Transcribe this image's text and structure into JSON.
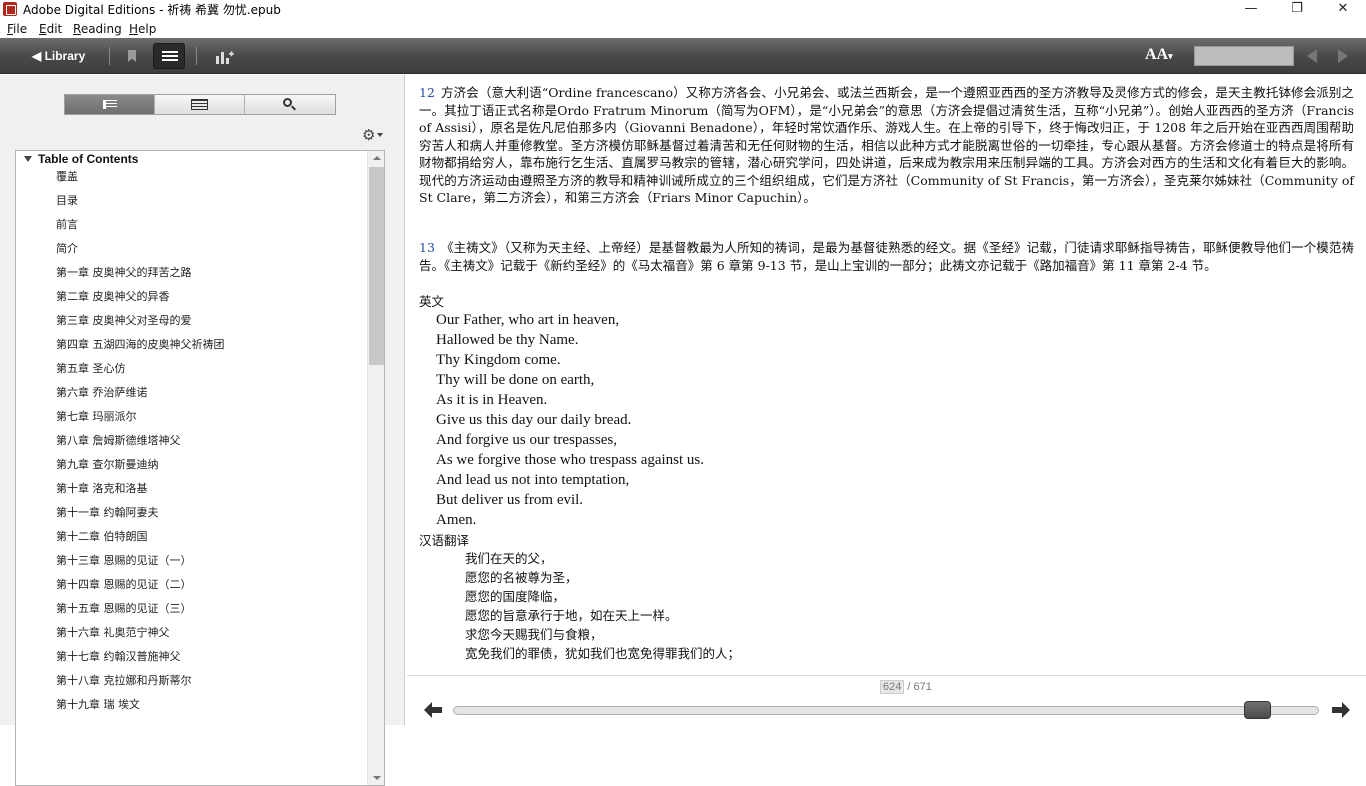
{
  "window": {
    "title": "Adobe Digital Editions - 祈祷 希冀 勿忧.epub",
    "minimize": "—",
    "maximize": "❐",
    "close": "✕"
  },
  "menu": [
    {
      "key": "F",
      "rest": "ile"
    },
    {
      "key": "E",
      "rest": "dit"
    },
    {
      "key": "R",
      "rest": "eading"
    },
    {
      "key": "H",
      "rest": "elp"
    }
  ],
  "toolbar": {
    "library_label": "◀ Library",
    "font_size_label": "AA",
    "font_size_caret": "▾",
    "zoom_value": ""
  },
  "sidebar": {
    "tabs": [
      "document-icon",
      "annotations-icon",
      "search-icon"
    ],
    "toc_title": "Table of Contents",
    "toc_items": [
      "覆盖",
      "目录",
      "前言",
      "简介",
      "第一章 皮奥神父的拜苦之路",
      "第二章 皮奥神父的异香",
      "第三章 皮奥神父对圣母的爱",
      "第四章 五湖四海的皮奥神父祈祷团",
      "第五章 圣心仿",
      "第六章 乔治萨维诺",
      "第七章 玛丽派尔",
      "第八章 詹姆斯德维塔神父",
      "第九章 查尔斯曼迪纳",
      "第十章 洛克和洛基",
      "第十一章 约翰阿妻夫",
      "第十二章 伯特朗国",
      "第十三章 恩赐的见证（一）",
      "第十四章 恩赐的见证（二）",
      "第十五章 恩赐的见证（三）",
      "第十六章 礼奥范宁神父",
      "第十七章 约翰汉普施神父",
      "第十八章 克拉娜和丹斯蒂尔",
      "第十九章 瑞 埃文"
    ]
  },
  "content": {
    "footnote12": {
      "number": "12",
      "text": "方济会（意大利语“Ordine francescano）又称方济各会、小兄弟会、或法兰西斯会，是一个遵照亚西西的圣方济教导及灵修方式的修会，是天主教托钵修会派别之一。其拉丁语正式名称是Ordo Fratrum Minorum（简写为OFM），是“小兄弟会”的意思（方济会提倡过清贫生活，互称“小兄弟”）。创始人亚西西的圣方济（Francis of Assisi），原名是佐凡尼伯那多内（Giovanni Benadone），年轻时常饮酒作乐、游戏人生。在上帝的引导下，终于悔改归正，于 1208 年之后开始在亚西西周围帮助穷苦人和病人并重修教堂。圣方济模仿耶稣基督过着清苦和无任何财物的生活，相信以此种方式才能脱离世俗的一切牵挂，专心跟从基督。方济会修道士的特点是将所有财物都捐给穷人，靠布施行乞生活、直属罗马教宗的管辖，潜心研究学问，四处讲道，后来成为教宗用来压制异端的工具。方济会对西方的生活和文化有着巨大的影响。现代的方济运动由遵照圣方济的教导和精神训诫所成立的三个组织组成，它们是方济社（Community of St Francis，第一方济会），圣克莱尔姊妹社（Community of St Clare，第二方济会），和第三方济会（Friars Minor Capuchin）。"
    },
    "footnote13": {
      "number": "13",
      "text": "《主祷文》（又称为天主经、上帝经）是基督教最为人所知的祷词，是最为基督徒熟悉的经文。据《圣经》记载，门徒请求耶稣指导祷告，耶稣便教导他们一个模范祷告。《主祷文》记载于《新约圣经》的《马太福音》第 6 章第 9-13 节，是山上宝训的一部分；此祷文亦记载于《路加福音》第 11 章第 2-4 节。"
    },
    "english_heading": "英文",
    "english_lines": [
      "Our Father, who art in heaven,",
      "Hallowed be thy Name.",
      "Thy Kingdom come.",
      "Thy will be done on earth,",
      "As it is in Heaven.",
      "Give us this day our daily bread.",
      "And forgive us our trespasses,",
      "As we forgive those who trespass against us.",
      "And lead us not into temptation,",
      "But deliver us from evil.",
      "Amen."
    ],
    "chinese_heading": "汉语翻译",
    "chinese_lines": [
      "我们在天的父，",
      "愿您的名被尊为圣，",
      "愿您的国度降临，",
      "愿您的旨意承行于地，如在天上一样。",
      "求您今天赐我们与食粮，",
      "宽免我们的罪债，犹如我们也宽免得罪我们的人；"
    ]
  },
  "navigation": {
    "current_page": "624",
    "separator": "/",
    "total_pages": "671",
    "progress": 0.929
  }
}
